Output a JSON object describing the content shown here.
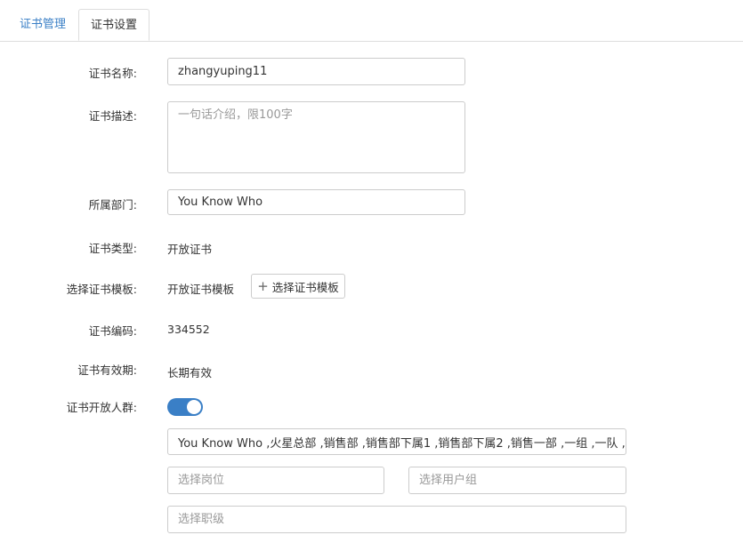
{
  "tabs": [
    {
      "label": "证书管理"
    },
    {
      "label": "证书设置"
    }
  ],
  "form": {
    "name_label": "证书名称:",
    "name_value": "zhangyuping11",
    "desc_label": "证书描述:",
    "desc_placeholder": "一句话介绍，限100字",
    "dept_label": "所属部门:",
    "dept_value": "You Know Who",
    "type_label": "证书类型:",
    "type_value": "开放证书",
    "template_label": "选择证书模板:",
    "template_value": "开放证书模板",
    "template_button": "选择证书模板",
    "code_label": "证书编码:",
    "code_value": "334552",
    "validity_label": "证书有效期:",
    "validity_value": "长期有效",
    "audience_label": "证书开放人群:",
    "audience_enabled": true,
    "audience_groups": "You Know Who ,火星总部 ,销售部 ,销售部下属1 ,销售部下属2 ,销售一部 ,一组 ,一队 ,一小",
    "position_placeholder": "选择岗位",
    "usergroup_placeholder": "选择用户组",
    "level_placeholder": "选择职级"
  },
  "colors": {
    "accent": "#3a7fc6",
    "border": "#cccccc"
  },
  "icons": {
    "plus": "plus-icon"
  }
}
